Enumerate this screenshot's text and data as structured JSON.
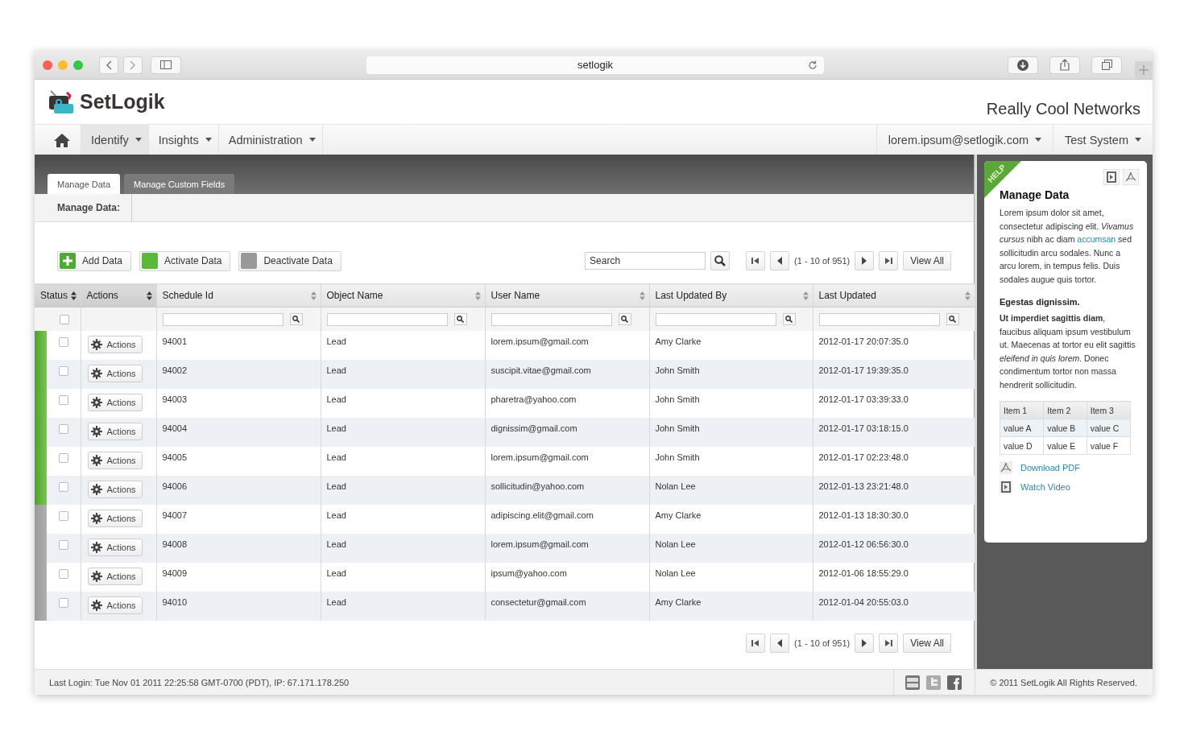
{
  "browser": {
    "url": "setlogik"
  },
  "header": {
    "brand": "SetLogik",
    "company": "Really Cool Networks"
  },
  "nav": {
    "items": [
      {
        "label": "Identify",
        "selected": true
      },
      {
        "label": "Insights",
        "selected": false
      },
      {
        "label": "Administration",
        "selected": false
      }
    ],
    "right": [
      {
        "label": "lorem.ipsum@setlogik.com"
      },
      {
        "label": "Test System"
      }
    ]
  },
  "tabs": [
    {
      "label": "Manage Data",
      "selected": true
    },
    {
      "label": "Manage Custom Fields",
      "selected": false
    }
  ],
  "breadcrumb": "Manage Data:",
  "toolbar": {
    "buttons": [
      {
        "label": "Add Data",
        "kind": "add"
      },
      {
        "label": "Activate Data",
        "kind": "activate"
      },
      {
        "label": "Deactivate Data",
        "kind": "deactivate"
      }
    ],
    "search": {
      "placeholder": "Search"
    }
  },
  "pager": {
    "range": "(1 - 10 of 951)",
    "view_all": "View All"
  },
  "table": {
    "columns": [
      {
        "label": "Status",
        "filter": false
      },
      {
        "label": "Actions",
        "filter": false
      },
      {
        "label": "Schedule Id",
        "filter": true
      },
      {
        "label": "Object Name",
        "filter": true
      },
      {
        "label": "User Name",
        "filter": true
      },
      {
        "label": "Last Updated By",
        "filter": true
      },
      {
        "label": "Last Updated",
        "filter": true
      }
    ],
    "select_all": {
      "checked": false
    },
    "rows": [
      {
        "active": true,
        "checked": false,
        "action": "Actions",
        "id": "94001",
        "object": "Lead",
        "user": "lorem.ipsum@gmail.com",
        "updated_by": "Amy Clarke",
        "updated": "2012-01-17 20:07:35.0"
      },
      {
        "active": true,
        "checked": false,
        "action": "Actions",
        "id": "94002",
        "object": "Lead",
        "user": "suscipit.vitae@gmail.com",
        "updated_by": "John Smith",
        "updated": "2012-01-17 19:39:35.0"
      },
      {
        "active": true,
        "checked": false,
        "action": "Actions",
        "id": "94003",
        "object": "Lead",
        "user": "pharetra@yahoo.com",
        "updated_by": "John Smith",
        "updated": "2012-01-17 03:39:33.0"
      },
      {
        "active": true,
        "checked": false,
        "action": "Actions",
        "id": "94004",
        "object": "Lead",
        "user": "dignissim@gmail.com",
        "updated_by": "John Smith",
        "updated": "2012-01-17 03:18:15.0"
      },
      {
        "active": true,
        "checked": false,
        "action": "Actions",
        "id": "94005",
        "object": "Lead",
        "user": "lorem.ipsum@gmail.com",
        "updated_by": "John Smith",
        "updated": "2012-01-17 02:23:48.0"
      },
      {
        "active": true,
        "checked": false,
        "action": "Actions",
        "id": "94006",
        "object": "Lead",
        "user": "sollicitudin@yahoo.com",
        "updated_by": "Nolan Lee",
        "updated": "2012-01-13 23:21:48.0"
      },
      {
        "active": false,
        "checked": false,
        "action": "Actions",
        "id": "94007",
        "object": "Lead",
        "user": "adipiscing.elit@gmail.com",
        "updated_by": "Amy Clarke",
        "updated": "2012-01-13 18:30:30.0"
      },
      {
        "active": false,
        "checked": false,
        "action": "Actions",
        "id": "94008",
        "object": "Lead",
        "user": "lorem.ipsum@gmail.com",
        "updated_by": "Nolan Lee",
        "updated": "2012-01-12 06:56:30.0"
      },
      {
        "active": false,
        "checked": false,
        "action": "Actions",
        "id": "94009",
        "object": "Lead",
        "user": "ipsum@yahoo.com",
        "updated_by": "Nolan Lee",
        "updated": "2012-01-06 18:55:29.0"
      },
      {
        "active": false,
        "checked": false,
        "action": "Actions",
        "id": "94010",
        "object": "Lead",
        "user": "consectetur@gmail.com",
        "updated_by": "Amy Clarke",
        "updated": "2012-01-04 20:55:03.0"
      }
    ]
  },
  "bottom_pager": {
    "range": "(1 - 10 of 951)",
    "view_all": "View All"
  },
  "help": {
    "ribbon": "HELP",
    "title": "Manage Data",
    "paragraph_1": {
      "before": "Lorem ipsum dolor sit amet, consectetur adipiscing elit. *Vivamus cursus* nibh ac diam",
      "link": "accumsan",
      "after": "sed sollicitudin arcu sodales. Nunc a arcu lorem, in tempus felis. Duis sodales augue quis tortor."
    },
    "subtitle": "Egestas dignissim.",
    "paragraph_2": "**Ut imperdiet sagittis diam**, faucibus aliquam ipsum vestibulum ut. Maecenas at tortor eu elit sagittis *eleifend in quis lorem*. Donec condimentum tortor non massa hendrerit sollicitudin.",
    "table": {
      "columns": [
        "Item 1",
        "Item 2",
        "Item 3"
      ],
      "rows": [
        [
          "value A",
          "value B",
          "value C"
        ],
        [
          "value D",
          "value E",
          "value F"
        ]
      ]
    },
    "links": [
      {
        "label": "Download PDF",
        "kind": "pdf"
      },
      {
        "label": "Watch Video",
        "kind": "video"
      }
    ]
  },
  "footer": {
    "last_login": "Last Login: Tue Nov 01 2011 22:25:58 GMT-0700 (PDT), IP: 67.171.178.250",
    "copyright": "© 2011 SetLogik All Rights Reserved."
  }
}
